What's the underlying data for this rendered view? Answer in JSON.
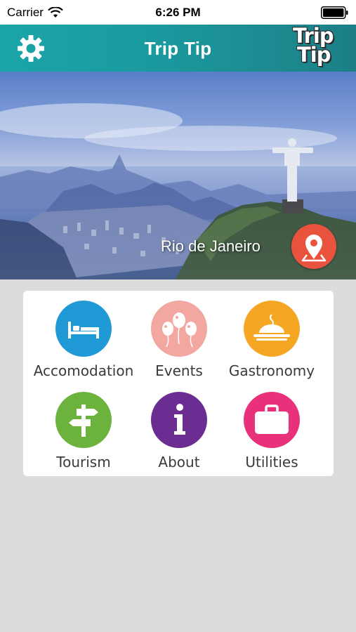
{
  "status_bar": {
    "carrier": "Carrier",
    "time": "6:26 PM"
  },
  "nav": {
    "title": "Trip Tip",
    "logo_line1": "Trip",
    "logo_line2": "Tip"
  },
  "hero": {
    "city": "Rio de Janeiro"
  },
  "menu": {
    "items": [
      {
        "label": "Accomodation",
        "icon": "bed-icon",
        "color": "#1f9ad6"
      },
      {
        "label": "Events",
        "icon": "balloons-icon",
        "color": "#f2a7a1"
      },
      {
        "label": "Gastronomy",
        "icon": "food-platter-icon",
        "color": "#f5a623"
      },
      {
        "label": "Tourism",
        "icon": "signpost-icon",
        "color": "#6cb33e"
      },
      {
        "label": "About",
        "icon": "info-icon",
        "color": "#6b2d91"
      },
      {
        "label": "Utilities",
        "icon": "suitcase-icon",
        "color": "#e8317a"
      }
    ]
  },
  "colors": {
    "nav_start": "#1aa5a9",
    "nav_end": "#1d7f86",
    "pin": "#e9533d",
    "background": "#dcdcdc"
  }
}
